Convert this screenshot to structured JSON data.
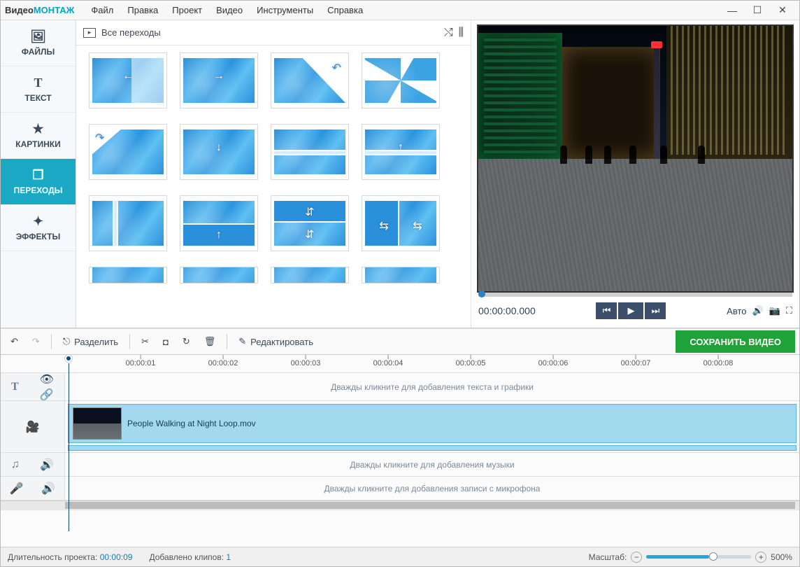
{
  "app": {
    "title_a": "Видео",
    "title_b": "МОНТАЖ"
  },
  "menu": [
    "Файл",
    "Правка",
    "Проект",
    "Видео",
    "Инструменты",
    "Справка"
  ],
  "left_tabs": [
    {
      "id": "files",
      "label": "ФАЙЛЫ",
      "icon": "🖼"
    },
    {
      "id": "text",
      "label": "ТЕКСТ",
      "icon": "T"
    },
    {
      "id": "pictures",
      "label": "КАРТИНКИ",
      "icon": "★"
    },
    {
      "id": "transitions",
      "label": "ПЕРЕХОДЫ",
      "icon": "❐"
    },
    {
      "id": "effects",
      "label": "ЭФФЕКТЫ",
      "icon": "✦"
    }
  ],
  "center": {
    "title": "Все переходы"
  },
  "preview": {
    "timecode": "00:00:00.000",
    "auto_label": "Авто"
  },
  "action_bar": {
    "split": "Разделить",
    "edit": "Редактировать",
    "save": "СОХРАНИТЬ ВИДЕО"
  },
  "timeline": {
    "ticks": [
      "00:00:01",
      "00:00:02",
      "00:00:03",
      "00:00:04",
      "00:00:05",
      "00:00:06",
      "00:00:07",
      "00:00:08"
    ],
    "text_placeholder": "Дважды кликните для добавления текста и графики",
    "music_placeholder": "Дважды кликните для добавления музыки",
    "mic_placeholder": "Дважды кликните для добавления записи с микрофона",
    "clip_name": "People Walking at Night Loop.mov"
  },
  "status": {
    "duration_label": "Длительность проекта:",
    "duration_value": "00:00:09",
    "clips_label": "Добавлено клипов:",
    "clips_value": "1",
    "zoom_label": "Масштаб:",
    "zoom_value": "500%"
  }
}
